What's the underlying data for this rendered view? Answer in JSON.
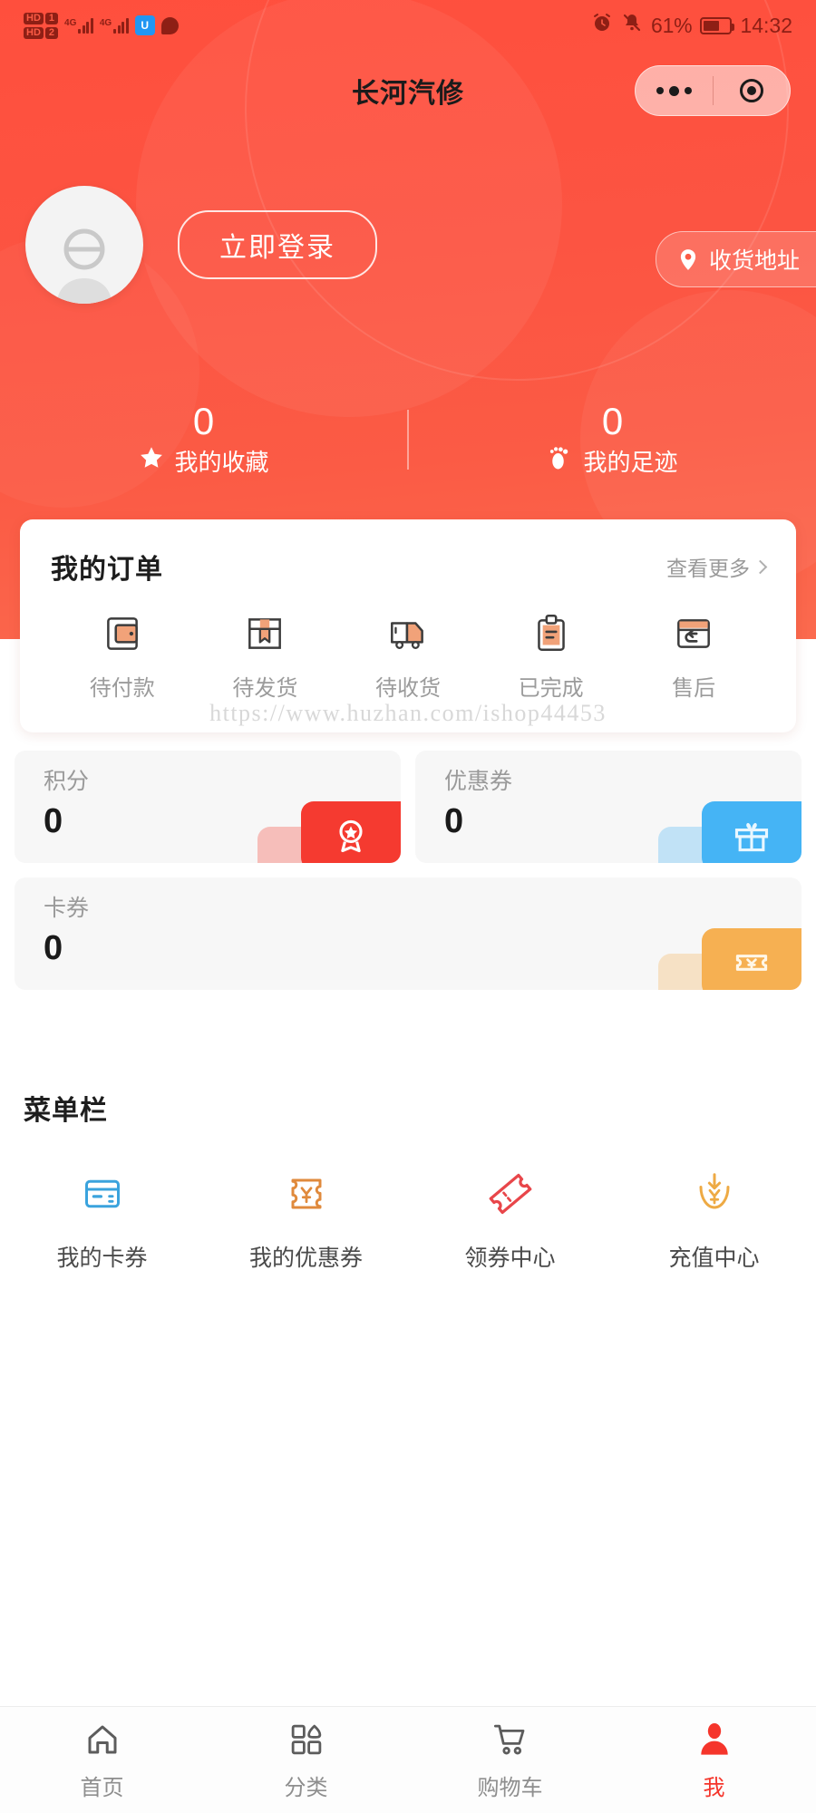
{
  "statusbar": {
    "hd1_tag": "HD",
    "hd1_num": "1",
    "hd2_tag": "HD",
    "hd2_num": "2",
    "net1": "4G",
    "net2": "4G",
    "shield_glyph": "U",
    "battery_percent": "61%",
    "battery_level": 61,
    "time": "14:32",
    "icons": [
      "alarm-icon",
      "bell-muted-icon",
      "battery-icon"
    ]
  },
  "header": {
    "app_title": "长河汽修",
    "capsule": {
      "more_icon": "ellipsis-icon",
      "target_icon": "target-icon"
    },
    "login_label": "立即登录",
    "address_label": "收货地址",
    "address_icon": "location-pin-icon",
    "avatar_icon": "default-avatar-icon",
    "accent": "#fb5b45"
  },
  "stats": [
    {
      "value": "0",
      "label": "我的收藏",
      "icon": "star-icon"
    },
    {
      "value": "0",
      "label": "我的足迹",
      "icon": "footprint-icon"
    }
  ],
  "orders": {
    "title": "我的订单",
    "more_label": "查看更多",
    "more_icon": "chevron-right-icon",
    "items": [
      {
        "label": "待付款",
        "icon": "wallet-icon"
      },
      {
        "label": "待发货",
        "icon": "package-icon"
      },
      {
        "label": "待收货",
        "icon": "truck-icon"
      },
      {
        "label": "已完成",
        "icon": "clipboard-icon"
      },
      {
        "label": "售后",
        "icon": "return-icon"
      }
    ]
  },
  "assets": [
    {
      "label": "积分",
      "value": "0",
      "icon": "medal-star-icon",
      "color": "#f53a30"
    },
    {
      "label": "优惠券",
      "value": "0",
      "icon": "gift-icon",
      "color": "#45b4f5"
    },
    {
      "label": "卡券",
      "value": "0",
      "icon": "ticket-yuan-icon",
      "color": "#f6b052"
    }
  ],
  "watermark": "https://www.huzhan.com/ishop44453",
  "menu": {
    "title": "菜单栏",
    "items": [
      {
        "label": "我的卡券",
        "icon": "card-icon",
        "color": "#3aa3dd"
      },
      {
        "label": "我的优惠券",
        "icon": "coupon-yuan-icon",
        "color": "#e08a3c"
      },
      {
        "label": "领券中心",
        "icon": "tilted-ticket-icon",
        "color": "#e8464a"
      },
      {
        "label": "充值中心",
        "icon": "recharge-icon",
        "color": "#eeaa44"
      }
    ]
  },
  "tabbar": {
    "items": [
      {
        "label": "首页",
        "icon": "home-icon",
        "active": false
      },
      {
        "label": "分类",
        "icon": "grid-icon",
        "active": false
      },
      {
        "label": "购物车",
        "icon": "cart-icon",
        "active": false
      },
      {
        "label": "我",
        "icon": "person-icon",
        "active": true
      }
    ],
    "active_color": "#f5352b"
  }
}
